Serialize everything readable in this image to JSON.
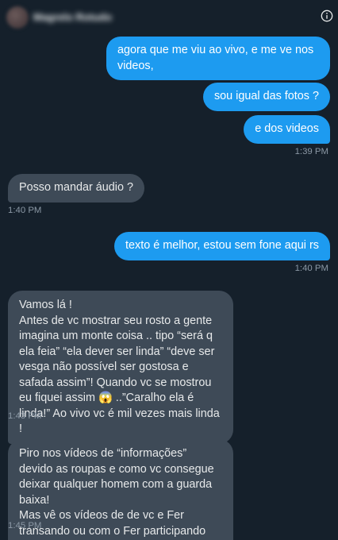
{
  "header": {
    "contact_name": "Magrelo Rotudo",
    "avatar_icon": "avatar-blurred",
    "info_icon": "info-circle-icon"
  },
  "messages": [
    {
      "direction": "out",
      "text": "agora que me viu ao vivo, e me ve nos videos,"
    },
    {
      "direction": "out",
      "text": "sou igual das fotos ?"
    },
    {
      "direction": "out",
      "text": "e dos videos",
      "time": "1:39 PM"
    },
    {
      "direction": "in",
      "text": "Posso mandar áudio ?",
      "time": "1:40 PM"
    },
    {
      "direction": "out",
      "text": "texto é melhor, estou sem fone aqui rs",
      "time": "1:40 PM"
    },
    {
      "direction": "in",
      "text": "Vamos lá !\nAntes de vc mostrar seu rosto a gente imagina um monte coisa .. tipo “será q ela feia” “ela dever ser linda” “deve ser vesga não possível ser gostosa e safada assim”! Quando vc se mostrou eu fiquei assim 😱 ..”Caralho ela é linda!” Ao vivo vc é mil vezes mais linda !",
      "time": "1:43 PM"
    },
    {
      "direction": "in",
      "text": "Piro nos vídeos de “informações” devido as roupas e como vc consegue deixar qualquer homem com a guarda baixa!\nMas vê os vídeos de de vc e Fer transando ou com o Fer participando me excita mais",
      "time": "1:45 PM"
    }
  ],
  "colors": {
    "background": "#15202b",
    "outgoing_bubble": "#1d9bf0",
    "incoming_bubble": "#3e4a57",
    "timestamp": "#8b98a5"
  }
}
